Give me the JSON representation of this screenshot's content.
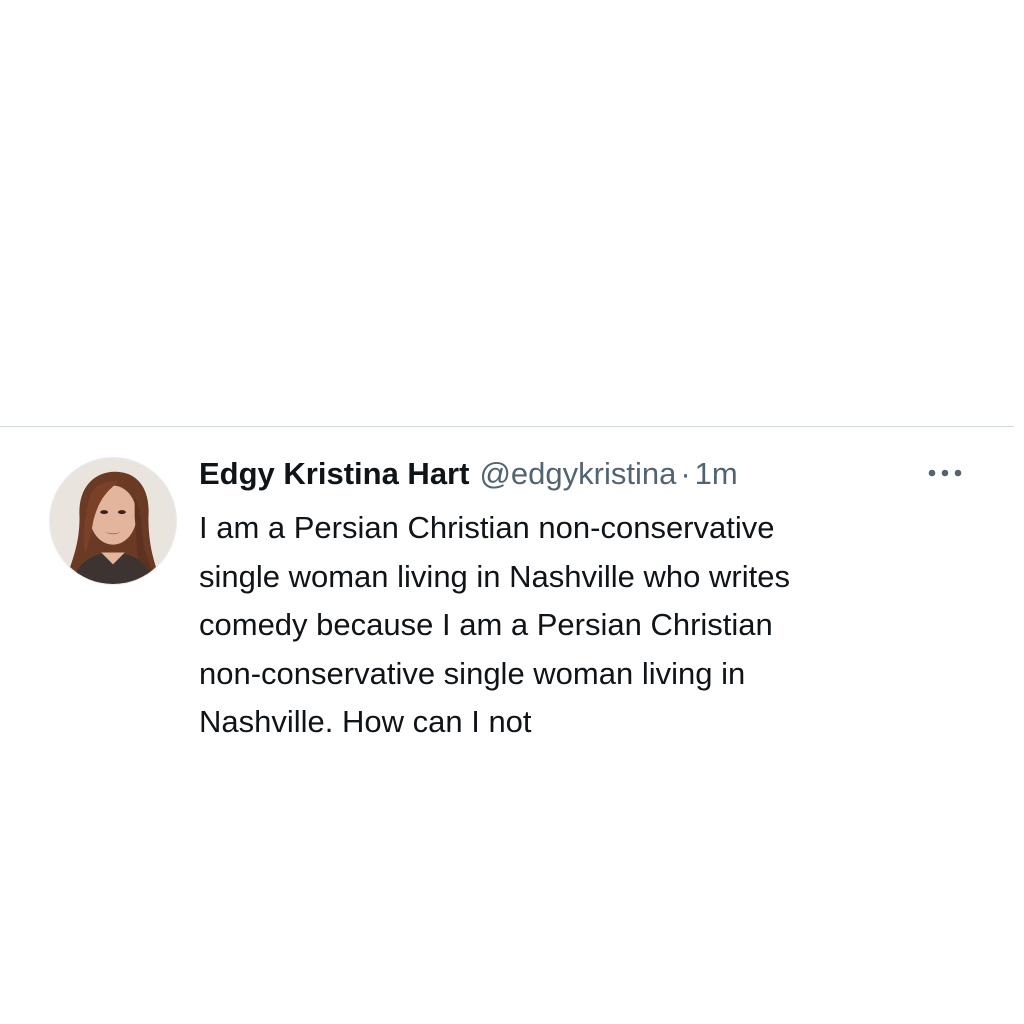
{
  "tweet": {
    "display_name": "Edgy Kristina Hart",
    "handle": "@edgykristina",
    "separator": "·",
    "timestamp": "1m",
    "text": "I am a Persian Christian non-conservative\nsingle woman living in Nashville who writes\ncomedy because I am a Persian Christian\nnon-conservative single woman living in\nNashville. How can I not",
    "more_icon": "more-horizontal-icon",
    "avatar_icon": "profile-photo"
  },
  "colors": {
    "text_primary": "#0f1419",
    "text_secondary": "#536471",
    "divider": "#cfd9de",
    "background": "#ffffff"
  }
}
